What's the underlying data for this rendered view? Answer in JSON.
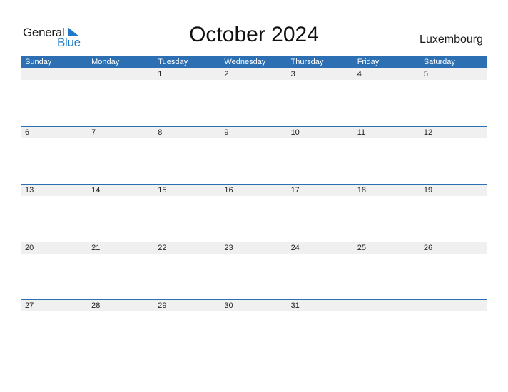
{
  "logo": {
    "part1": "General",
    "part2": "Blue"
  },
  "title": "October 2024",
  "country": "Luxembourg",
  "weekdays": [
    "Sunday",
    "Monday",
    "Tuesday",
    "Wednesday",
    "Thursday",
    "Friday",
    "Saturday"
  ],
  "weeks": [
    [
      "",
      "",
      "1",
      "2",
      "3",
      "4",
      "5"
    ],
    [
      "6",
      "7",
      "8",
      "9",
      "10",
      "11",
      "12"
    ],
    [
      "13",
      "14",
      "15",
      "16",
      "17",
      "18",
      "19"
    ],
    [
      "20",
      "21",
      "22",
      "23",
      "24",
      "25",
      "26"
    ],
    [
      "27",
      "28",
      "29",
      "30",
      "31",
      "",
      ""
    ]
  ],
  "colors": {
    "accent": "#2c6fb2",
    "logo_blue": "#1f7bc8",
    "strip": "#f0f0f0"
  }
}
